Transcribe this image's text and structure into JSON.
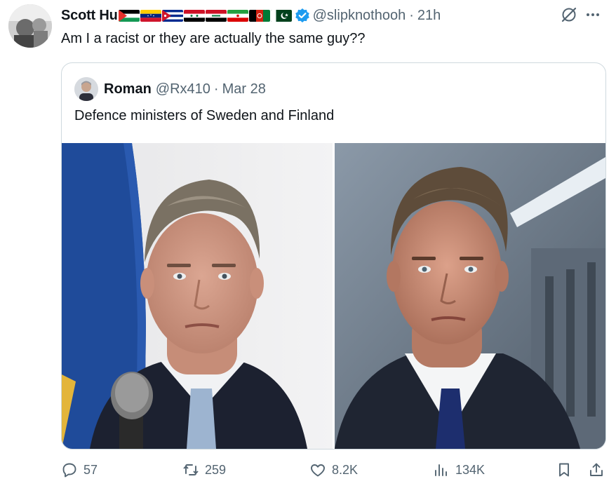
{
  "tweet": {
    "author_name": "Scott Hu",
    "flags": [
      "palestine-flag",
      "venezuela-flag",
      "cuba-flag",
      "syria-flag",
      "iraq-flag",
      "iran-flag",
      "afghanistan-flag",
      "pakistan-flag"
    ],
    "verified_icon": "verified-badge-icon",
    "handle": "@slipknothooh",
    "separator": "·",
    "time": "21h",
    "text": "Am I a racist or they are actually the same guy??"
  },
  "quoted": {
    "author_name": "Roman",
    "handle": "@Rx410",
    "separator": "·",
    "date": "Mar 28",
    "text": "Defence ministers of Sweden and Finland",
    "images": [
      "photo-man-with-microphone",
      "photo-man-in-suit"
    ]
  },
  "actions": {
    "replies": "57",
    "reposts": "259",
    "likes": "8.2K",
    "views": "134K"
  },
  "colors": {
    "text": "#0f1419",
    "secondary": "#536471",
    "border": "#cfd9de",
    "verified": "#1d9bf0"
  }
}
